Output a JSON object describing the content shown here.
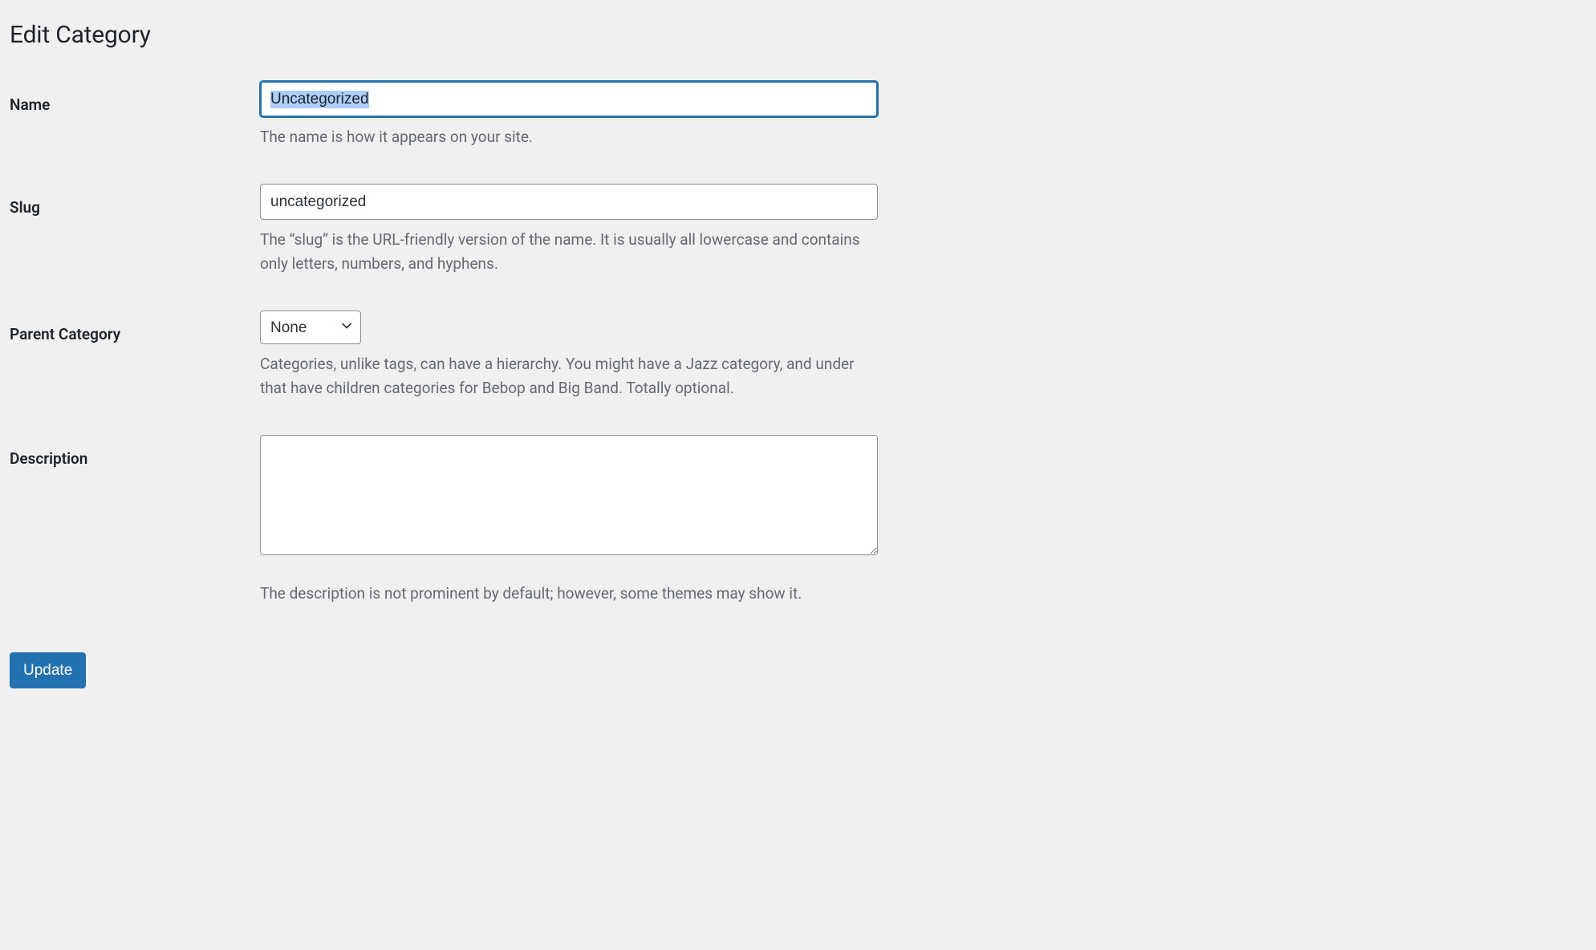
{
  "page": {
    "title": "Edit Category"
  },
  "fields": {
    "name": {
      "label": "Name",
      "value": "Uncategorized",
      "help": "The name is how it appears on your site."
    },
    "slug": {
      "label": "Slug",
      "value": "uncategorized",
      "help": "The “slug” is the URL-friendly version of the name. It is usually all lowercase and contains only letters, numbers, and hyphens."
    },
    "parent": {
      "label": "Parent Category",
      "selected": "None",
      "help": "Categories, unlike tags, can have a hierarchy. You might have a Jazz category, and under that have children categories for Bebop and Big Band. Totally optional."
    },
    "description": {
      "label": "Description",
      "value": "",
      "help": "The description is not prominent by default; however, some themes may show it."
    }
  },
  "actions": {
    "submit_label": "Update"
  }
}
